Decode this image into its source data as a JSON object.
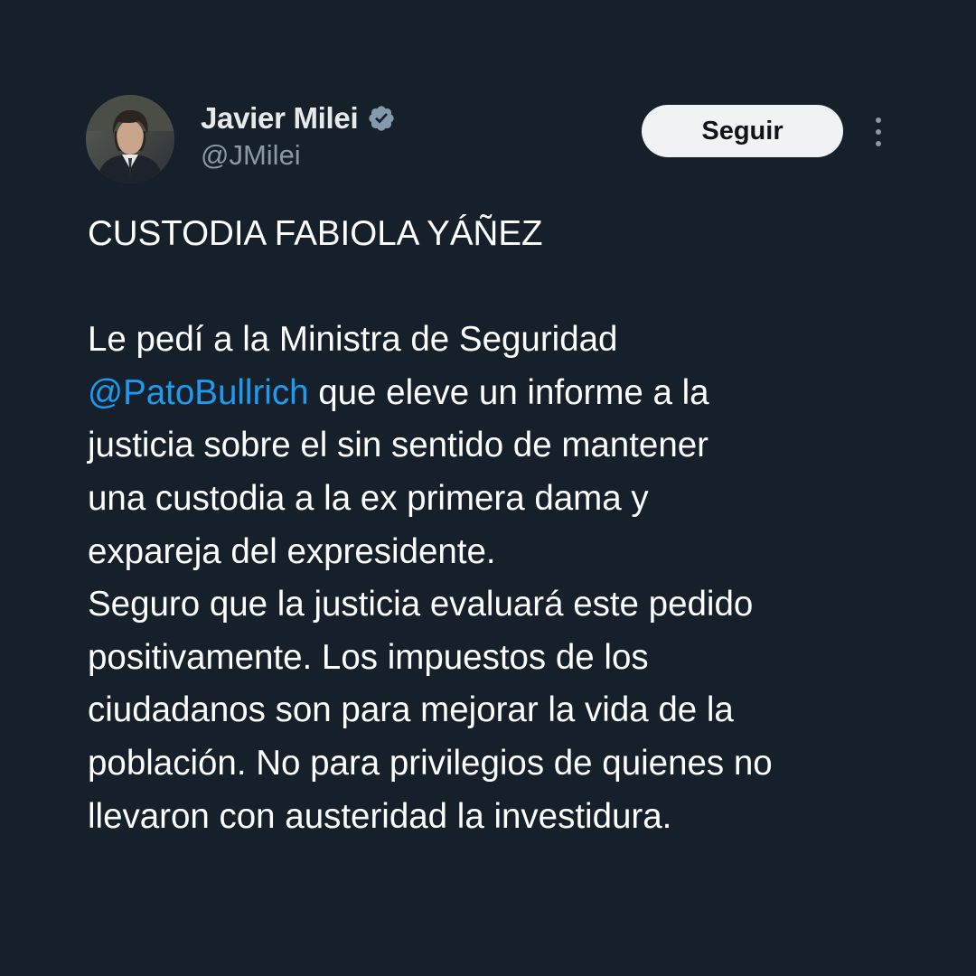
{
  "author": {
    "display_name": "Javier Milei",
    "handle": "@JMilei",
    "verified": true,
    "verified_icon": "verified-badge-icon"
  },
  "actions": {
    "follow_label": "Seguir",
    "more_icon": "more-vertical-icon"
  },
  "tweet": {
    "title_line": "CUSTODIA FABIOLA YÁÑEZ",
    "lines": [
      "Le pedí a la Ministra de Seguridad",
      "que eleve un informe a la",
      "justicia sobre el sin sentido de mantener",
      "una custodia a la ex primera dama y",
      "expareja del expresidente.",
      "Seguro que la justicia evaluará este pedido",
      "positivamente. Los impuestos de los",
      "ciudadanos son para mejorar la vida de la",
      "población. No para privilegios de quienes no",
      "llevaron con austeridad la investidura."
    ],
    "mention": "@PatoBullrich"
  },
  "colors": {
    "background": "#16202a",
    "text": "#ffffff",
    "secondary_text": "#8b98a5",
    "mention": "#1d9bf0",
    "verified_badge": "#829aab",
    "follow_button_bg": "#eff3f4"
  }
}
